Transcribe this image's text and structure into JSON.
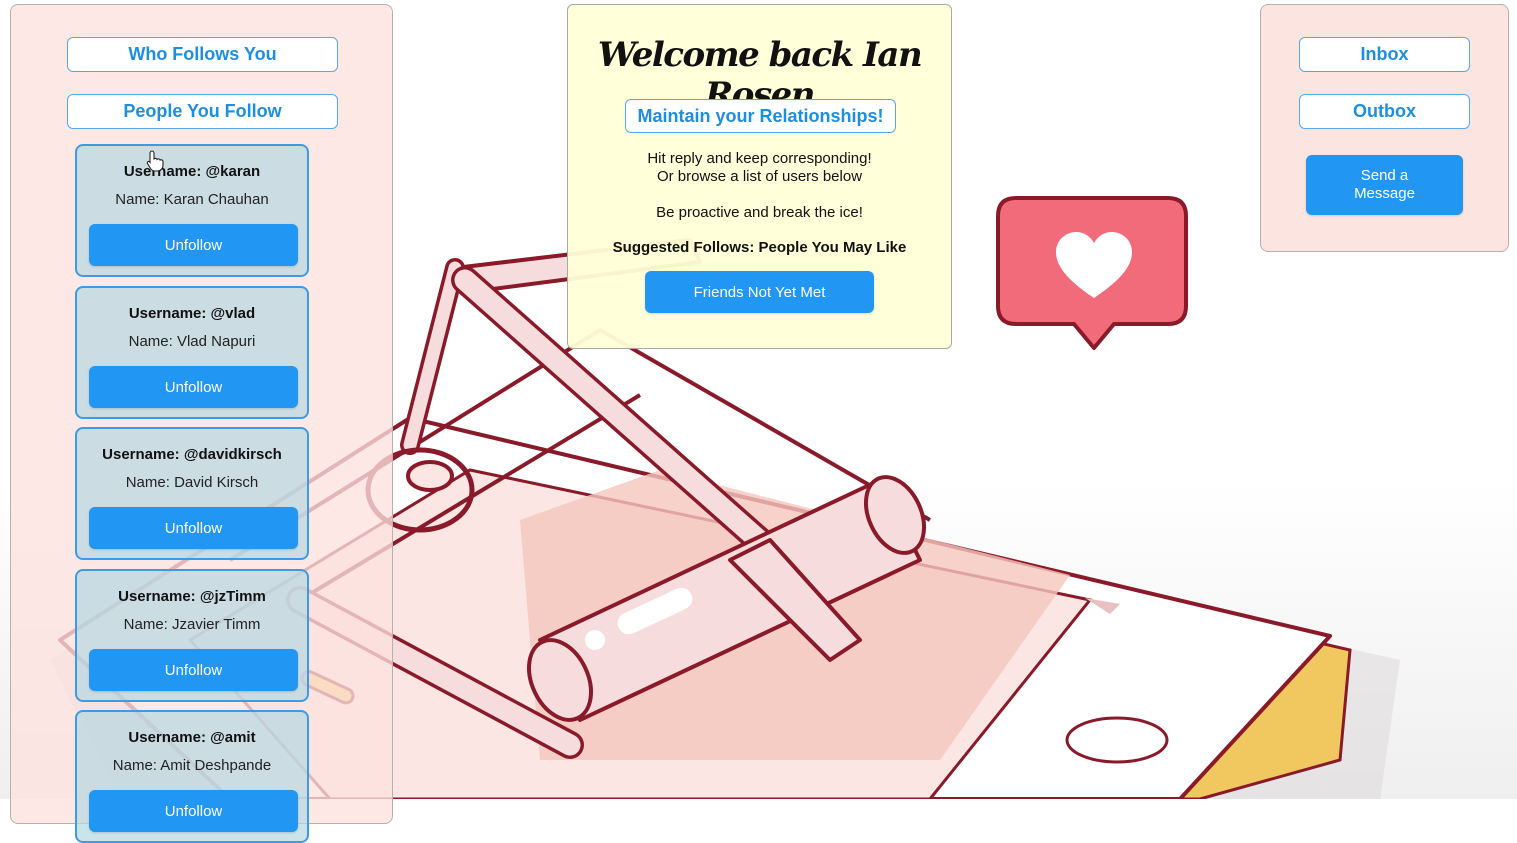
{
  "left_panel": {
    "who_follows_label": "Who Follows You",
    "people_follow_label": "People You Follow",
    "users": [
      {
        "username": "Username: @karan",
        "name": "Name: Karan Chauhan",
        "action": "Unfollow"
      },
      {
        "username": "Username: @vlad",
        "name": "Name: Vlad Napuri",
        "action": "Unfollow"
      },
      {
        "username": "Username: @davidkirsch",
        "name": "Name: David Kirsch",
        "action": "Unfollow"
      },
      {
        "username": "Username: @jzTimm",
        "name": "Name: Jzavier Timm",
        "action": "Unfollow"
      },
      {
        "username": "Username: @amit",
        "name": "Name: Amit Deshpande",
        "action": "Unfollow"
      }
    ]
  },
  "center_panel": {
    "welcome": "Welcome back Ian Rosen",
    "maintain_label": "Maintain your Relationships!",
    "line1": "Hit reply and keep corresponding!",
    "line2": "Or browse a list of users below",
    "line3": "Be proactive and break the ice!",
    "suggested": "Suggested Follows: People You May Like",
    "friends_button": "Friends Not Yet Met"
  },
  "right_panel": {
    "inbox_label": "Inbox",
    "outbox_label": "Outbox",
    "send_line1": "Send a",
    "send_line2": "Message"
  },
  "colors": {
    "accent": "#2196f3",
    "left_panel_bg": "#fce2de",
    "center_panel_bg": "#ffffd7",
    "card_bg": "#b7d8e2",
    "heart_bubble": "#f26b7a"
  },
  "icons": {
    "background": "mousetrap-phone-illustration",
    "bubble": "heart-speech-bubble-icon",
    "cursor": "hand-pointer-cursor"
  }
}
